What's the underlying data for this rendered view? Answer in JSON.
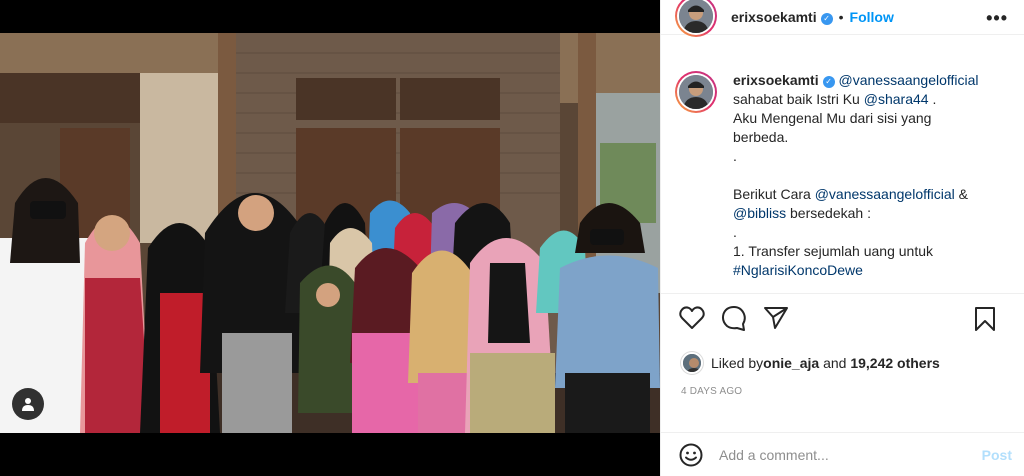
{
  "post": {
    "username": "erixsoekamti",
    "verified_icon": "verified-badge-icon",
    "separator": "•",
    "follow_label": "Follow",
    "more_label": "•••"
  },
  "caption": {
    "username": "erixsoekamti",
    "lines": [
      {
        "mention": "@vanessaangelofficial"
      },
      {
        "pre": "sahabat baik Istri Ku ",
        "mention": "@shara44",
        "post": " ."
      },
      {
        "text": "Aku Mengenal Mu dari sisi yang"
      },
      {
        "text": "berbeda."
      },
      {
        "text": "."
      },
      {
        "text": ""
      },
      {
        "pre": "Berikut Cara ",
        "mention": "@vanessaangelofficial",
        "post": " &"
      },
      {
        "mention": "@bibliss",
        "post": " bersedekah :"
      },
      {
        "text": "."
      },
      {
        "text": "1. Transfer sejumlah uang untuk"
      },
      {
        "tag": "#NglarisiKoncoDewe"
      }
    ]
  },
  "actions": {
    "like_icon": "heart-icon",
    "comment_icon": "comment-icon",
    "share_icon": "share-icon",
    "save_icon": "bookmark-icon"
  },
  "likes": {
    "prefix": "Liked by ",
    "user": "onie_aja",
    "middle": " and ",
    "count": "19,242 others"
  },
  "timestamp": "4 DAYS AGO",
  "comment": {
    "placeholder": "Add a comment...",
    "post_label": "Post"
  },
  "colors": {
    "accent": "#0095f6",
    "link": "#00376b",
    "muted": "#8e8e8e",
    "post_disabled": "#b2dffc"
  }
}
